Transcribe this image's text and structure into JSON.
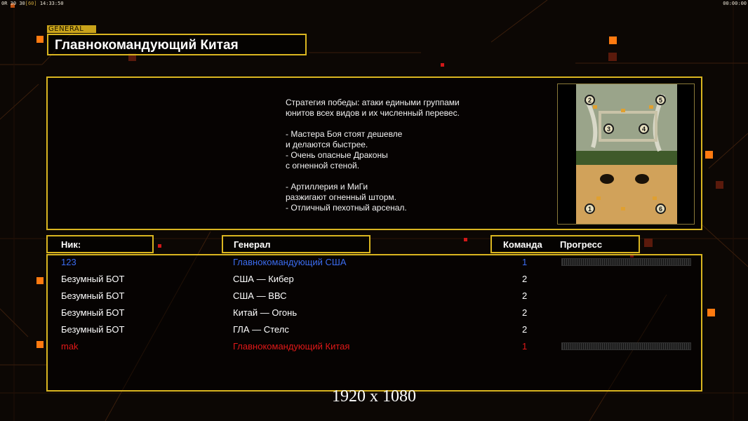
{
  "topbar": {
    "left_a": "0R",
    "left_b": "30",
    "left_c": "30",
    "left_d": "[60]",
    "left_time": "14:33:50",
    "right_time": "00:00:00"
  },
  "header": {
    "tag": "GENERAL",
    "title": "Главнокомандующий Китая"
  },
  "info": {
    "description": "Стратегия победы: атаки едиными группами\nюнитов всех видов и их численный перевес.\n\n- Мастера Боя стоят дешевле\nи делаются быстрее.\n- Очень опасные Драконы\nс огненной стеной.\n\n- Артиллерия и МиГи\nразжигают огненный шторм.\n- Отличный пехотный арсенал.",
    "map_spots": [
      "2",
      "5",
      "3",
      "4",
      "1",
      "6"
    ]
  },
  "columns": {
    "nick": "Ник:",
    "general": "Генерал",
    "team": "Команда",
    "progress": "Прогресс"
  },
  "players": [
    {
      "nick": "123",
      "general": "Главнокомандующий США",
      "team": "1",
      "color": "#3b6cf0",
      "progress": 0
    },
    {
      "nick": "Безумный БОТ",
      "general": "США — Кибер",
      "team": "2",
      "color": "#ffffff"
    },
    {
      "nick": "Безумный БОТ",
      "general": "США — ВВС",
      "team": "2",
      "color": "#ffffff"
    },
    {
      "nick": "Безумный БОТ",
      "general": "Китай — Огонь",
      "team": "2",
      "color": "#ffffff"
    },
    {
      "nick": "Безумный БОТ",
      "general": "ГЛА — Стелс",
      "team": "2",
      "color": "#ffffff"
    },
    {
      "nick": "mak",
      "general": "Главнокомандующий Китая",
      "team": "1",
      "color": "#e01818",
      "progress": 0
    }
  ],
  "resolution": "1920 x 1080",
  "colors": {
    "accent": "#d9b520",
    "background": "#0c0704"
  }
}
